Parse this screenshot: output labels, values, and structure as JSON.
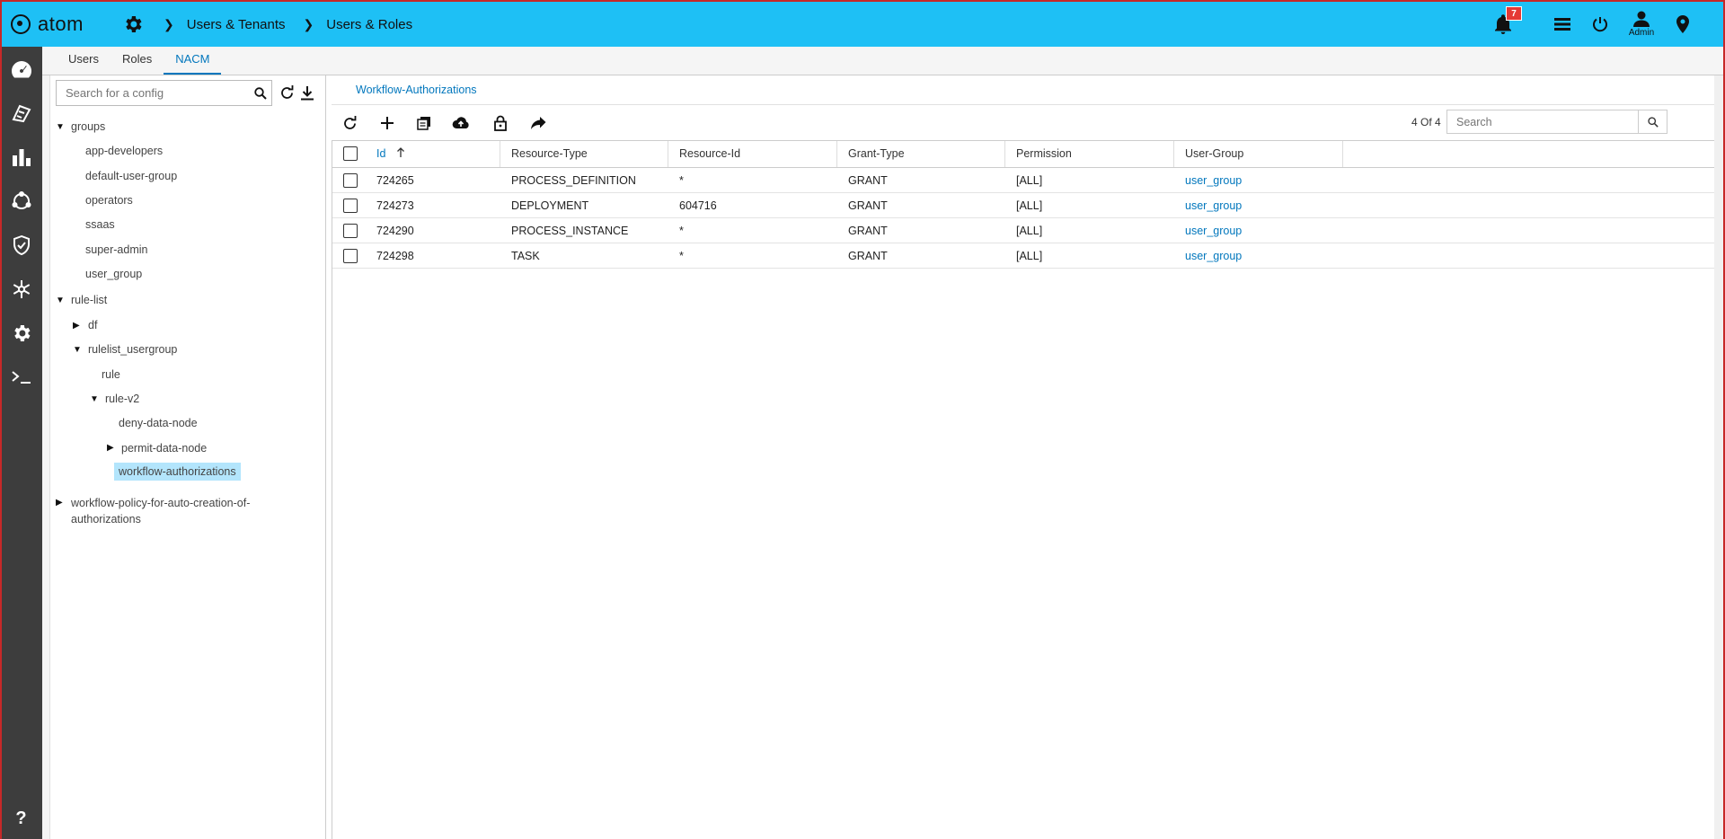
{
  "header": {
    "logo_text": "atom",
    "breadcrumbs": [
      "Users & Tenants",
      "Users & Roles"
    ],
    "notification_count": "7",
    "admin_label": "Admin"
  },
  "tabs": [
    {
      "label": "Users"
    },
    {
      "label": "Roles"
    },
    {
      "label": "NACM",
      "active": true
    }
  ],
  "tree": {
    "search_placeholder": "Search for a config",
    "nodes": {
      "groups": "groups",
      "app_developers": "app-developers",
      "default_user_group": "default-user-group",
      "operators": "operators",
      "ssaas": "ssaas",
      "super_admin": "super-admin",
      "user_group": "user_group",
      "rule_list": "rule-list",
      "df": "df",
      "rulelist_usergroup": "rulelist_usergroup",
      "rule": "rule",
      "rule_v2": "rule-v2",
      "deny_data_node": "deny-data-node",
      "permit_data_node": "permit-data-node",
      "workflow_authorizations": "workflow-authorizations",
      "workflow_policy_line1": "workflow-policy-for-auto-creation-of-",
      "workflow_policy_line2": "authorizations"
    }
  },
  "main": {
    "breadcrumb": "Workflow-Authorizations",
    "count": "4 Of 4",
    "search_placeholder": "Search",
    "columns": [
      "Id",
      "Resource-Type",
      "Resource-Id",
      "Grant-Type",
      "Permission",
      "User-Group"
    ],
    "rows": [
      {
        "id": "724265",
        "resource_type": "PROCESS_DEFINITION",
        "resource_id": "*",
        "grant_type": "GRANT",
        "permission": "[ALL]",
        "user_group": "user_group"
      },
      {
        "id": "724273",
        "resource_type": "DEPLOYMENT",
        "resource_id": "604716",
        "grant_type": "GRANT",
        "permission": "[ALL]",
        "user_group": "user_group"
      },
      {
        "id": "724290",
        "resource_type": "PROCESS_INSTANCE",
        "resource_id": "*",
        "grant_type": "GRANT",
        "permission": "[ALL]",
        "user_group": "user_group"
      },
      {
        "id": "724298",
        "resource_type": "TASK",
        "resource_id": "*",
        "grant_type": "GRANT",
        "permission": "[ALL]",
        "user_group": "user_group"
      }
    ]
  },
  "help_label": "?",
  "colors": {
    "header_bg": "#1ec0f5",
    "nav_bg": "#3d3d3d",
    "accent": "#0277bd",
    "selected_bg": "#b3e5fc",
    "badge": "#e53935"
  },
  "icons": [
    "settings-icon",
    "chevron-right-icon",
    "notification-bell-icon",
    "list-icon",
    "power-icon",
    "user-icon",
    "location-pin-icon",
    "dashboard-icon",
    "devices-icon",
    "analytics-icon",
    "network-icon",
    "shield-icon",
    "snowflake-icon",
    "gear-icon",
    "terminal-icon",
    "search-icon",
    "refresh-icon",
    "download-icon",
    "add-icon",
    "copy-icon",
    "upload-icon",
    "lock-icon",
    "share-icon",
    "sort-up-icon"
  ]
}
